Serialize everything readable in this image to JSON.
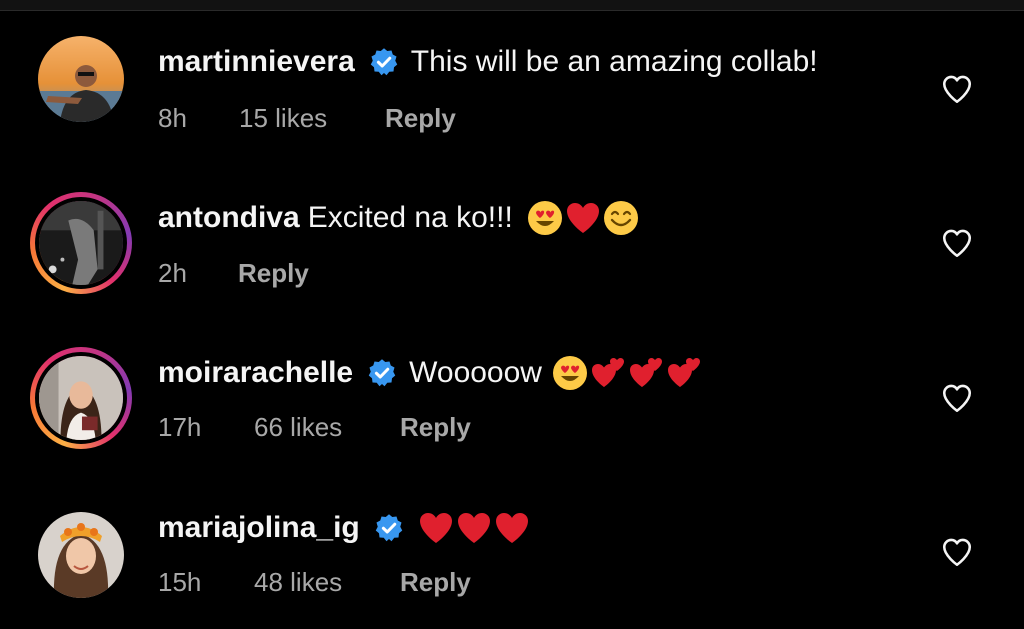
{
  "comments": [
    {
      "username": "martinnievera",
      "verified": true,
      "text": "This will be an amazing collab!",
      "emojis": [],
      "time": "8h",
      "likes": "15 likes",
      "reply": "Reply",
      "avatar_style": "plain"
    },
    {
      "username": "antondiva",
      "verified": false,
      "text": "Excited na ko!!!",
      "emojis": [
        "heart-eyes-emoji",
        "red-heart-emoji",
        "smiling-face-emoji"
      ],
      "time": "2h",
      "likes": "",
      "reply": "Reply",
      "avatar_style": "story"
    },
    {
      "username": "moirarachelle",
      "verified": true,
      "text": "Wooooow",
      "emojis": [
        "heart-eyes-emoji",
        "two-hearts-emoji",
        "two-hearts-emoji",
        "two-hearts-emoji"
      ],
      "time": "17h",
      "likes": "66 likes",
      "reply": "Reply",
      "avatar_style": "story"
    },
    {
      "username": "mariajolina_ig",
      "verified": true,
      "text": "",
      "emojis": [
        "red-heart-emoji",
        "red-heart-emoji",
        "red-heart-emoji"
      ],
      "time": "15h",
      "likes": "48 likes",
      "reply": "Reply",
      "avatar_style": "plain"
    }
  ],
  "colors": {
    "background": "#000000",
    "primary_text": "#f5f5f5",
    "secondary_text": "#a8a8a8",
    "verified_blue": "#3897f0",
    "heart_red": "#e0202e"
  }
}
